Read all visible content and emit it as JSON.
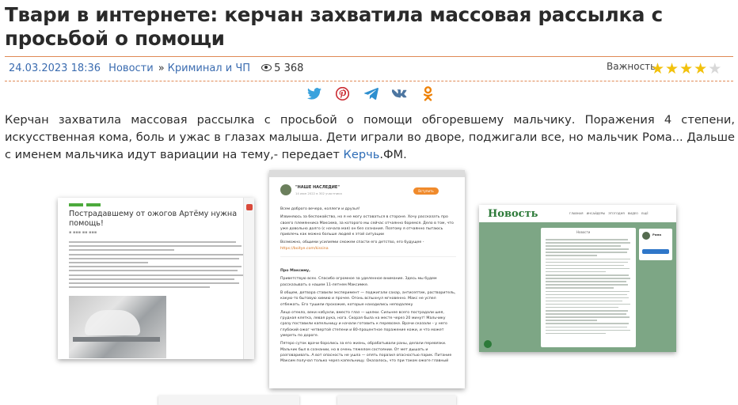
{
  "article": {
    "title": "Твари в интернете: керчан захватила массовая рассылка с просьбой о помощи",
    "date": "24.03.2023 18:36",
    "category": "Новости",
    "breadcrumb_sep": "»",
    "subcategory": "Криминал и ЧП",
    "views": "5 368",
    "importance_label": "Важность:",
    "importance_rating": 4,
    "importance_max": 5,
    "lead_text": "Керчан захватила массовая рассылка с просьбой о помощи обгоревшему мальчику. Поражения 4 степени, искусственная кома, боль и ужас в глазах малыша. Дети играли во дворе, поджигали все, но мальчик Рома... Дальше с именем мальчика идут вариации на тему,-  передает ",
    "source_link": "Керчь",
    "source_suffix": ".ФМ."
  },
  "share": [
    {
      "name": "twitter",
      "color": "#3aa2dd"
    },
    {
      "name": "pinterest",
      "color": "#c9262d"
    },
    {
      "name": "telegram",
      "color": "#2e8fcf"
    },
    {
      "name": "vkontakte",
      "color": "#4d76a1"
    },
    {
      "name": "odnoklassniki",
      "color": "#ee8208"
    }
  ],
  "screenshot1": {
    "title": "Пострадавшему от ожогов Артёму нужна помощь!"
  },
  "screenshot2": {
    "channel": "\"НАШЕ НАСЛЕДИЕ\"",
    "date": "14 июн 2022 в 302 участника",
    "button": "Вступить",
    "p1": "Всем доброго вечера, коллеги и друзья!",
    "p2": "Извиняюсь за беспокойство, но я не могу оставаться в стороне. Хочу рассказать про своего племянника Максима, за которого мы сейчас отчаянно боремся. Дело в том, что уже довольно долго (с начала мая) он без сознания. Поэтому я отчаянно пытаюсь привлечь как можно больше людей к этой ситуации",
    "p3": "Возможно, общими усилиями сможем спасти его детство, его будущее -",
    "link": "https://boitye.com/kissina",
    "greeting": "Про Максиму,",
    "p4": "Приветствую всех. Спасибо огромное за уделенное внимание. Здесь мы будем рассказывать о нашем 11-летнем Максимке.",
    "p5": "В общем, детвора ставили эксперимент — поджигали сахар, антисептик, растворитель, какую-то бытовую химию и прочее. Огонь вспыхнул мгновенно. Макс не успел отбежать. Его тушили прохожие, которые находились неподалеку",
    "p6": "Лицо отекло, веки набухли, вместо глаз — щелки. Сильнее всего пострадали шея, грудная клетка, левая рука, нога. Скорая была на месте через 20 минут! Мальчику сразу поставили капельницу и начали готовить к перевозке. Врачи сказали – у него глубокий ожог четвертой степени и 80-процентное поражение кожи, и что может умереть по дороге.",
    "p7": "Пятеро суток врачи боролись за его жизнь, обрабатывали раны, делали перевязки. Мальчик был в сознании, но в очень тяжелом состоянии. От мет дышать и разговаривать. А вот опасность не ушла — опять поразил опасностью парик. Питание Максим получал только через капельницу. Оказалось, что при таком ожоге главный"
  },
  "screenshot3": {
    "logo": "Новость",
    "nav": "ГЛАВНАЯ  ИНСАЙДЕРЫ  ЭТОГОДНЯ  ВИДЕО  ЕЩЁ",
    "feed_caption": "Новости",
    "profile_name": "Рома"
  }
}
